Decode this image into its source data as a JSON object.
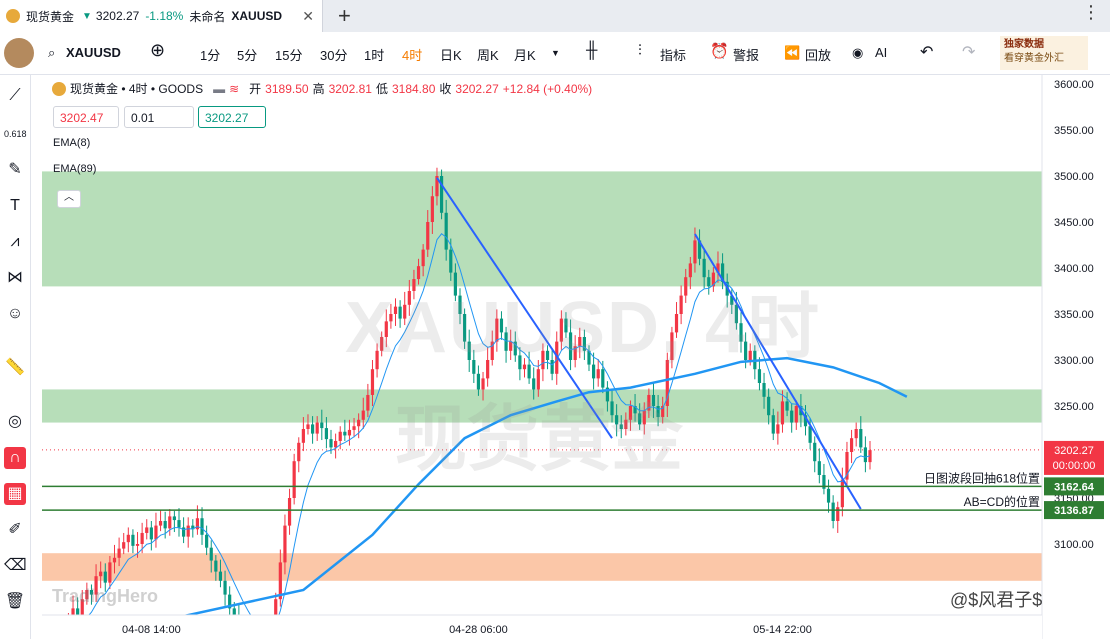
{
  "tab": {
    "name": "现货黄金",
    "price": "3202.27",
    "change": "-1.18%",
    "layout_name": "未命名",
    "symbol": "XAUUSD"
  },
  "toolbar": {
    "symbol": "XAUUSD",
    "intervals": [
      "1分",
      "5分",
      "15分",
      "30分",
      "1时",
      "4时",
      "日K",
      "周K",
      "月K"
    ],
    "active_interval": "4时",
    "indicators_label": "指标",
    "alert_label": "警报",
    "replay_label": "回放",
    "ai_label": "AI",
    "ad_line1": "独家数据",
    "ad_line2": "看穿黄金外汇"
  },
  "legend": {
    "title": "现货黄金 • 4时 • GOODS",
    "open_label": "开",
    "open": "3189.50",
    "high_label": "高",
    "high": "3202.81",
    "low_label": "低",
    "low": "3184.80",
    "close_label": "收",
    "close": "3202.27",
    "change": "+12.84 (+0.40%)",
    "sell_price": "3202.47",
    "spread": "0.01",
    "buy_price": "3202.27",
    "ema_fast": "EMA(8)",
    "ema_slow": "EMA(89)"
  },
  "watermark": {
    "line1": "XAUUSD, 4时",
    "line2": "现货黄金",
    "brand": "TradingHero"
  },
  "credit": "@$风君子$",
  "colors": {
    "up": "#f23645",
    "down": "#089981",
    "zone_green": "#b7deb9",
    "zone_orange": "#fbc7a8",
    "trendline": "#2962ff",
    "ema_slow": "#2196f3"
  },
  "chart_data": {
    "type": "candlestick",
    "ylim": [
      3080,
      3640
    ],
    "y_ticks": [
      3100,
      3150,
      3200,
      3250,
      3300,
      3350,
      3400,
      3450,
      3500,
      3550,
      3600
    ],
    "x_tick_labels": [
      "04-08 14:00",
      "04-28 06:00",
      "05-14 22:00"
    ],
    "close_series": [
      2978,
      2985,
      2990,
      3010,
      3018,
      3030,
      3008,
      3040,
      3050,
      3045,
      3065,
      3070,
      3058,
      3080,
      3085,
      3095,
      3102,
      3110,
      3098,
      3100,
      3112,
      3118,
      3105,
      3120,
      3125,
      3117,
      3130,
      3126,
      3118,
      3108,
      3120,
      3116,
      3128,
      3110,
      3096,
      3082,
      3070,
      3060,
      3045,
      3030,
      3020,
      3010,
      3000,
      2995,
      2990,
      2988,
      2985,
      2992,
      3010,
      3040,
      3080,
      3120,
      3150,
      3190,
      3210,
      3225,
      3230,
      3220,
      3232,
      3226,
      3214,
      3205,
      3212,
      3222,
      3218,
      3224,
      3228,
      3235,
      3245,
      3262,
      3290,
      3310,
      3325,
      3342,
      3350,
      3358,
      3345,
      3360,
      3375,
      3388,
      3402,
      3420,
      3450,
      3478,
      3500,
      3460,
      3420,
      3395,
      3370,
      3350,
      3320,
      3300,
      3285,
      3268,
      3280,
      3300,
      3320,
      3345,
      3330,
      3310,
      3320,
      3305,
      3290,
      3295,
      3280,
      3268,
      3290,
      3310,
      3300,
      3285,
      3320,
      3345,
      3330,
      3300,
      3315,
      3325,
      3310,
      3295,
      3280,
      3290,
      3270,
      3255,
      3240,
      3230,
      3225,
      3235,
      3250,
      3242,
      3230,
      3245,
      3262,
      3250,
      3238,
      3250,
      3300,
      3330,
      3350,
      3370,
      3390,
      3405,
      3430,
      3410,
      3390,
      3380,
      3395,
      3405,
      3385,
      3370,
      3360,
      3340,
      3320,
      3300,
      3310,
      3290,
      3275,
      3260,
      3240,
      3220,
      3230,
      3255,
      3245,
      3232,
      3250,
      3240,
      3228,
      3210,
      3190,
      3175,
      3160,
      3145,
      3125,
      3140,
      3170,
      3200,
      3215,
      3225,
      3205,
      3189,
      3202
    ],
    "ema_slow_points": [
      [
        0,
        2990
      ],
      [
        55,
        3050
      ],
      [
        70,
        3110
      ],
      [
        80,
        3165
      ],
      [
        90,
        3215
      ],
      [
        100,
        3240
      ],
      [
        110,
        3255
      ],
      [
        117,
        3265
      ],
      [
        126,
        3270
      ],
      [
        140,
        3285
      ],
      [
        150,
        3298
      ],
      [
        160,
        3302
      ],
      [
        170,
        3292
      ],
      [
        180,
        3275
      ],
      [
        186,
        3260
      ]
    ],
    "trendlines": [
      {
        "from": [
          84,
          3498
        ],
        "to": [
          122,
          3215
        ]
      },
      {
        "from": [
          140,
          3437
        ],
        "to": [
          176,
          3138
        ]
      }
    ],
    "zones": [
      {
        "from": 3380,
        "to": 3505,
        "color": "green"
      },
      {
        "from": 3232,
        "to": 3268,
        "color": "green"
      },
      {
        "from": 3060,
        "to": 3090,
        "color": "orange"
      }
    ],
    "hlines": [
      {
        "value": 3162.64,
        "label": "日图波段回抽618位置"
      },
      {
        "value": 3136.87,
        "label": "AB=CD的位置"
      }
    ],
    "last_price": 3202.27,
    "countdown": "00:00:00"
  }
}
